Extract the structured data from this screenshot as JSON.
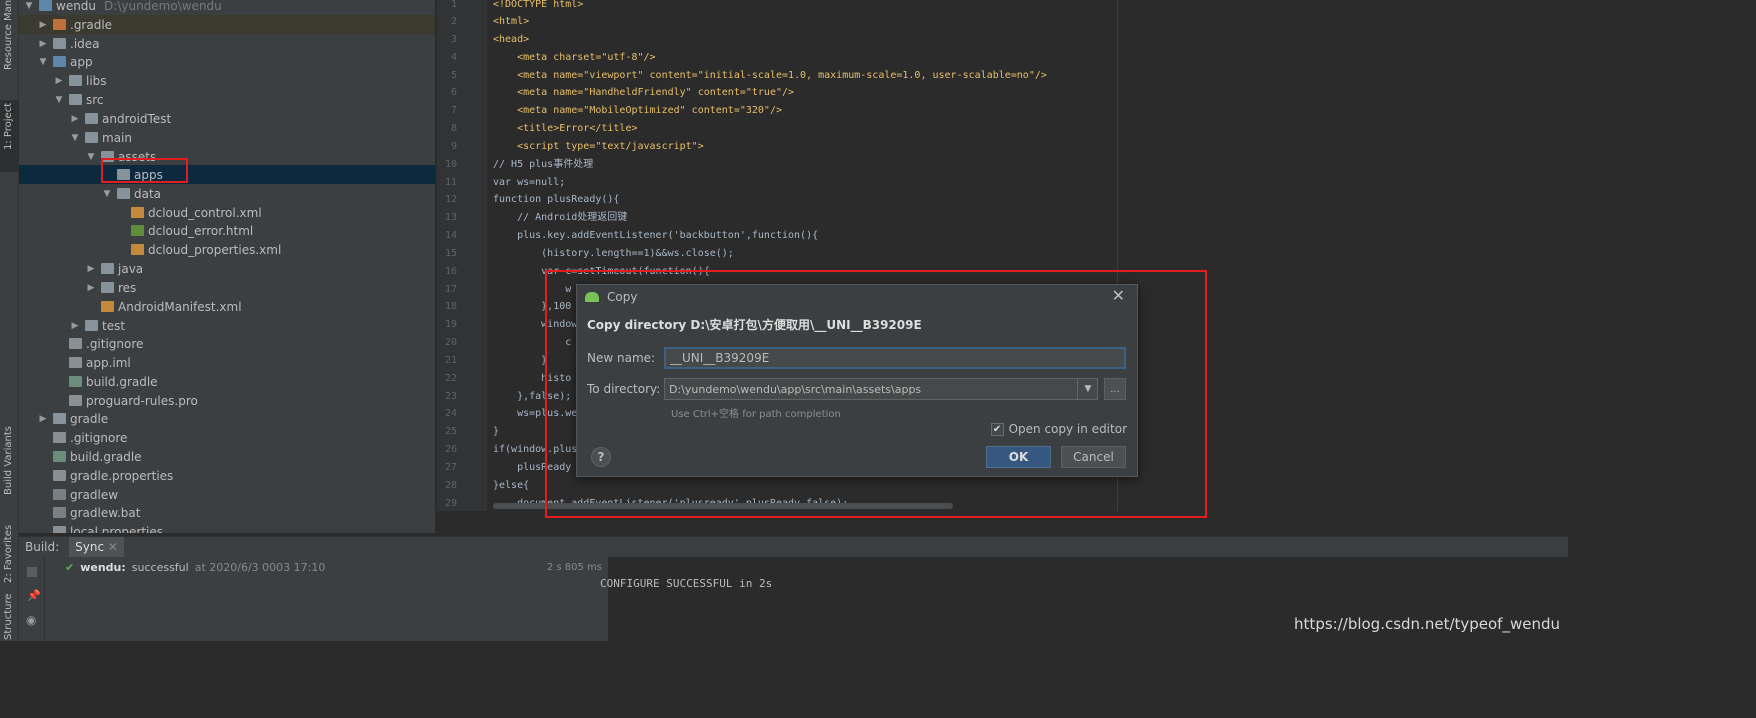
{
  "sidebar": {
    "tabs": [
      {
        "label": "Resource Manager"
      },
      {
        "label": "1: Project"
      },
      {
        "label": "Build Variants"
      },
      {
        "label": "2: Favorites"
      },
      {
        "label": "Structure"
      }
    ]
  },
  "project_tree": [
    {
      "label": "wendu",
      "hint": "D:\\yundemo\\wendu"
    },
    {
      "label": ".gradle"
    },
    {
      "label": ".idea"
    },
    {
      "label": "app"
    },
    {
      "label": "libs"
    },
    {
      "label": "src"
    },
    {
      "label": "androidTest"
    },
    {
      "label": "main"
    },
    {
      "label": "assets"
    },
    {
      "label": "apps"
    },
    {
      "label": "data"
    },
    {
      "label": "dcloud_control.xml"
    },
    {
      "label": "dcloud_error.html"
    },
    {
      "label": "dcloud_properties.xml"
    },
    {
      "label": "java"
    },
    {
      "label": "res"
    },
    {
      "label": "AndroidManifest.xml"
    },
    {
      "label": "test"
    },
    {
      "label": ".gitignore"
    },
    {
      "label": "app.iml"
    },
    {
      "label": "build.gradle"
    },
    {
      "label": "proguard-rules.pro"
    },
    {
      "label": "gradle"
    },
    {
      "label": ".gitignore"
    },
    {
      "label": "build.gradle"
    },
    {
      "label": "gradle.properties"
    },
    {
      "label": "gradlew"
    },
    {
      "label": "gradlew.bat"
    },
    {
      "label": "local.properties"
    }
  ],
  "editor": {
    "line_numbers": [
      "1",
      "2",
      "3",
      "4",
      "5",
      "6",
      "7",
      "8",
      "9",
      "10",
      "11",
      "12",
      "13",
      "14",
      "15",
      "16",
      "17",
      "18",
      "19",
      "20",
      "21",
      "22",
      "23",
      "24",
      "25",
      "26",
      "27",
      "28",
      "29"
    ],
    "lines": [
      "<!DOCTYPE html>",
      "<html>",
      "<head>",
      "    <meta charset=\"utf-8\"/>",
      "    <meta name=\"viewport\" content=\"initial-scale=1.0, maximum-scale=1.0, user-scalable=no\"/>",
      "    <meta name=\"HandheldFriendly\" content=\"true\"/>",
      "    <meta name=\"MobileOptimized\" content=\"320\"/>",
      "    <title>Error</title>",
      "    <script type=\"text/javascript\">",
      "// H5 plus事件处理",
      "var ws=null;",
      "function plusReady(){",
      "    // Android处理返回键",
      "    plus.key.addEventListener('backbutton',function(){",
      "        (history.length==1)&&ws.close();",
      "        var c=setTimeout(function(){",
      "            w",
      "        },100",
      "        window",
      "            c",
      "        }",
      "        histo",
      "    },false);",
      "    ws=plus.we",
      "}",
      "if(window.plus",
      "    plusReady",
      "}else{",
      "    document.addEventListener('plusready',plusReady,false);"
    ]
  },
  "build": {
    "label": "Build:",
    "tab": "Sync",
    "project": "wendu:",
    "result": "successful",
    "timestamp": "at 2020/6/3 0003 17:10",
    "duration": "2 s 805 ms",
    "console": "CONFIGURE SUCCESSFUL in 2s"
  },
  "dialog": {
    "title": "Copy",
    "subtitle": "Copy directory D:\\安卓打包\\方便取用\\__UNI__B39209E",
    "new_name_label": "New name:",
    "new_name_value": "__UNI__B39209E",
    "to_directory_label": "To directory:",
    "to_directory_value": "D:\\yundemo\\wendu\\app\\src\\main\\assets\\apps",
    "browse_label": "...",
    "hint": "Use Ctrl+空格 for path completion",
    "open_copy_label": "Open copy in editor",
    "open_copy_checked": true,
    "help_label": "?",
    "ok_label": "OK",
    "cancel_label": "Cancel"
  },
  "watermark": "https://blog.csdn.net/typeof_wendu"
}
